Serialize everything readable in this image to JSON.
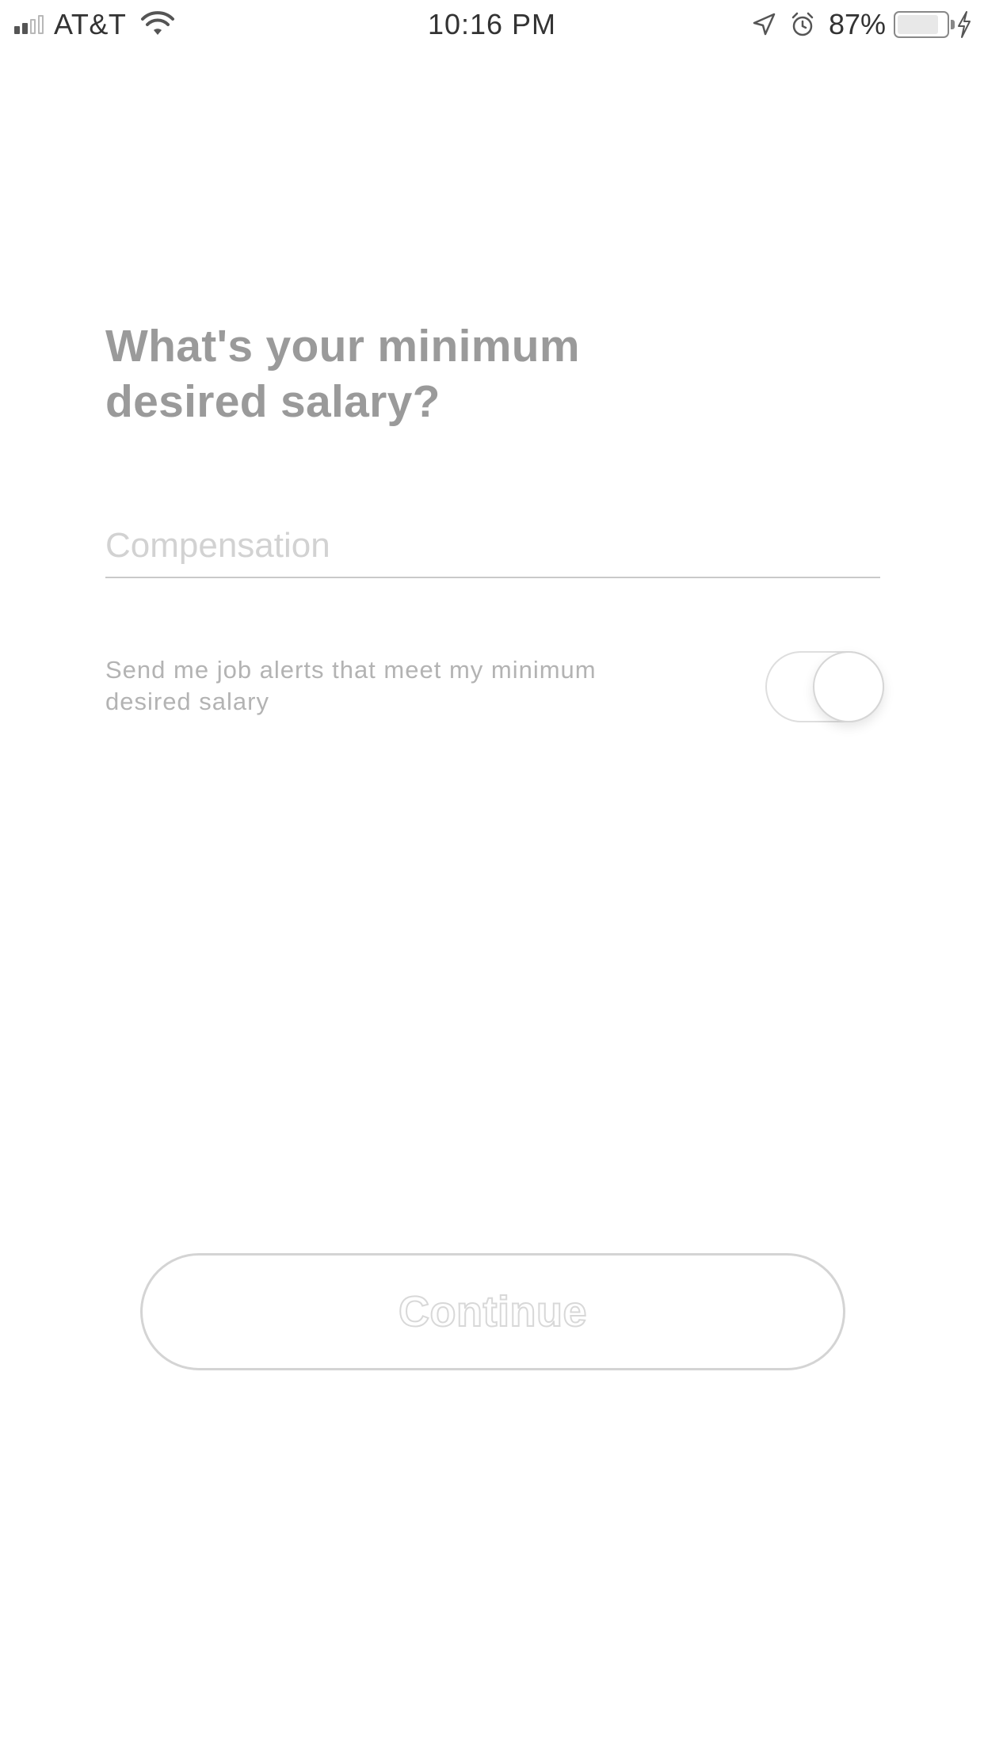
{
  "status_bar": {
    "carrier": "AT&T",
    "time": "10:16 PM",
    "battery_percent": "87%",
    "battery_level": 0.87,
    "signal_bars_filled": 2,
    "signal_bars_total": 4,
    "icons": [
      "signal-icon",
      "wifi-icon",
      "location-arrow-icon",
      "alarm-clock-icon",
      "battery-icon",
      "charging-bolt-icon"
    ]
  },
  "main": {
    "question": "What's your minimum desired salary?",
    "compensation": {
      "placeholder": "Compensation",
      "value": ""
    },
    "job_alerts": {
      "label": "Send me job alerts that meet my minimum desired salary",
      "enabled": true
    },
    "continue_label": "Continue"
  },
  "colors": {
    "background": "#ffffff",
    "question_text": "#9a9a9a",
    "placeholder_text": "#d2d2d2",
    "secondary_text": "#b3b3b3",
    "divider": "#c9c9c9",
    "button_border": "#d4d4d4"
  }
}
